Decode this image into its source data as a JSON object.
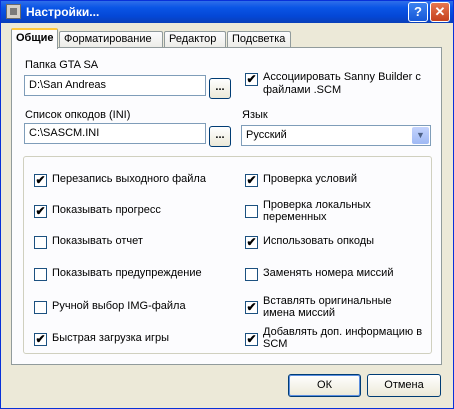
{
  "window": {
    "title": "Настройки..."
  },
  "titlebar": {
    "help_label": "?",
    "close_label": "✕"
  },
  "tabs": [
    {
      "label": "Общие"
    },
    {
      "label": "Форматирование"
    },
    {
      "label": "Редактор"
    },
    {
      "label": "Подсветка"
    }
  ],
  "gta_folder": {
    "label": "Папка GTA SA",
    "value": "D:\\San Andreas",
    "browse_label": "..."
  },
  "opcodes_list": {
    "label": "Список опкодов (INI)",
    "value": "C:\\SASCM.INI",
    "browse_label": "..."
  },
  "associate": {
    "label_line1": "Ассоциировать Sanny Builder с",
    "label_line2": "файлами .SCM",
    "checked": true
  },
  "language": {
    "label": "Язык",
    "selected": "Русский"
  },
  "options_left": [
    {
      "label": "Перезапись выходного файла",
      "checked": true
    },
    {
      "label": "Показывать прогресс",
      "checked": true
    },
    {
      "label": "Показывать отчет",
      "checked": false
    },
    {
      "label": "Показывать предупреждение",
      "checked": false
    },
    {
      "label": "Ручной выбор IMG-файла",
      "checked": false
    },
    {
      "label": "Быстрая загрузка игры",
      "checked": true
    }
  ],
  "options_right": [
    {
      "label": "Проверка условий",
      "checked": true
    },
    {
      "label": "Проверка локальных",
      "label2": "переменных",
      "checked": false
    },
    {
      "label": "Использовать опкоды",
      "checked": true
    },
    {
      "label": "Заменять номера миссий",
      "checked": false
    },
    {
      "label": "Вставлять оригинальные",
      "label2": "имена миссий",
      "checked": true
    },
    {
      "label": "Добавлять доп. информацию в",
      "label2": "SCM",
      "checked": true
    }
  ],
  "buttons": {
    "ok": "ОК",
    "cancel": "Отмена"
  },
  "check_mark": "✔"
}
